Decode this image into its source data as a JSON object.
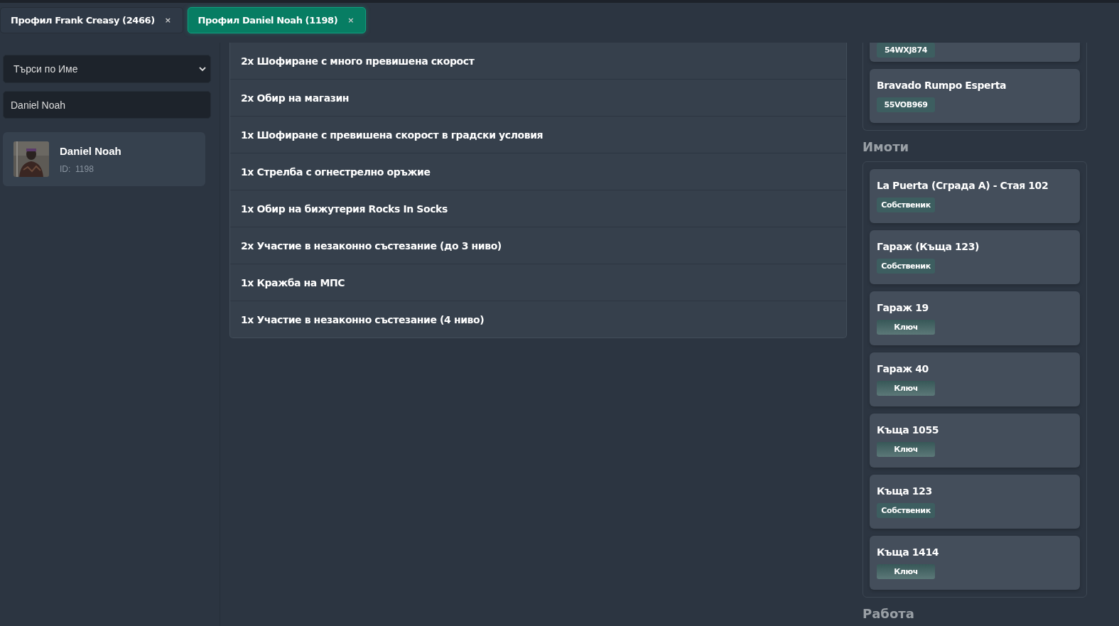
{
  "tabs": [
    {
      "label": "Профил Frank Creasy (2466)",
      "close": "×",
      "selected": false
    },
    {
      "label": "Профил Daniel Noah (1198)",
      "close": "×",
      "selected": true
    }
  ],
  "sidebar": {
    "search_mode": "Търси по Име",
    "search_value": "Daniel Noah",
    "results": [
      {
        "name": "Daniel Noah",
        "id_label": "ID:",
        "id": "1198"
      }
    ]
  },
  "charges": [
    "2x Шофиране с много превишена скорост",
    "2x Обир на магазин",
    "1x Шофиране с превишена скорост в градски условия",
    "1x Стрелба с огнестрелно оръжие",
    "1x Обир на бижутерия Rocks In Socks",
    "2x Участие в незаконно състезание (до 3 ниво)",
    "1x Кражба на МПС",
    "1x Участие в незаконно състезание (4 ниво)"
  ],
  "vehicles": [
    {
      "plate": "54WXJ874"
    },
    {
      "name": "Bravado Rumpo Esperta",
      "plate": "55VOB969"
    }
  ],
  "properties_heading": "Имоти",
  "properties": [
    {
      "name": "La Puerta (Сграда А) - Стая 102",
      "tag": "Собственик",
      "kind": "owner"
    },
    {
      "name": "Гараж (Къща 123)",
      "tag": "Собственик",
      "kind": "owner"
    },
    {
      "name": "Гараж 19",
      "tag": "Ключ",
      "kind": "key"
    },
    {
      "name": "Гараж 40",
      "tag": "Ключ",
      "kind": "key"
    },
    {
      "name": "Къща 1055",
      "tag": "Ключ",
      "kind": "key"
    },
    {
      "name": "Къща 123",
      "tag": "Собственик",
      "kind": "owner"
    },
    {
      "name": "Къща 1414",
      "tag": "Ключ",
      "kind": "key"
    }
  ],
  "jobs_heading": "Работа"
}
